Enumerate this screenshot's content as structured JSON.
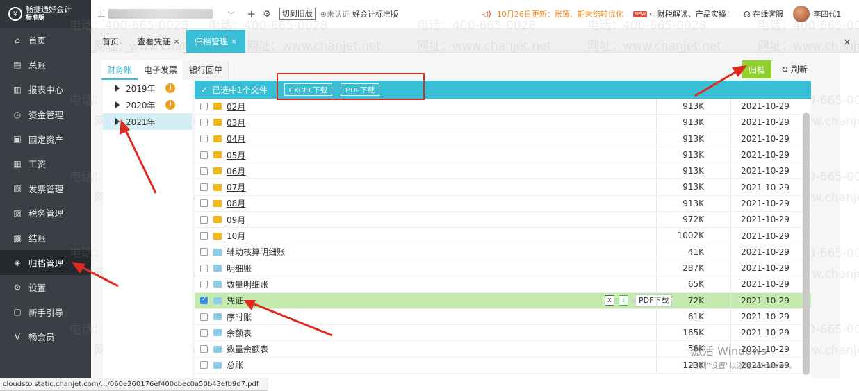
{
  "app": {
    "logo_name": "畅捷通好会计",
    "logo_edition": "标准版"
  },
  "sidebar": {
    "items": [
      {
        "label": "首页",
        "icon": "home-icon",
        "glyph": "⌂"
      },
      {
        "label": "总账",
        "icon": "ledger-icon",
        "glyph": "▤"
      },
      {
        "label": "报表中心",
        "icon": "chart-icon",
        "glyph": "▥"
      },
      {
        "label": "资金管理",
        "icon": "money-icon",
        "glyph": "◷"
      },
      {
        "label": "固定资产",
        "icon": "asset-icon",
        "glyph": "▣"
      },
      {
        "label": "工资",
        "icon": "salary-icon",
        "glyph": "▦"
      },
      {
        "label": "发票管理",
        "icon": "invoice-icon",
        "glyph": "▧"
      },
      {
        "label": "税务管理",
        "icon": "tax-icon",
        "glyph": "▨"
      },
      {
        "label": "结账",
        "icon": "checkout-icon",
        "glyph": "▩"
      },
      {
        "label": "归档管理",
        "icon": "archive-icon",
        "glyph": "◈",
        "active": true
      },
      {
        "label": "设置",
        "icon": "settings-icon",
        "glyph": "⚙"
      },
      {
        "label": "新手引导",
        "icon": "guide-icon",
        "glyph": "▢"
      },
      {
        "label": "畅会员",
        "icon": "member-icon",
        "glyph": "V"
      }
    ]
  },
  "topbar": {
    "company_prefix": "上",
    "switch_label": "切到旧版",
    "cert_label": "未认证",
    "edition_label": "好会计标准版",
    "notice": "10月26日更新：账簿、期末结转优化",
    "new_badge": "NEW",
    "tax_label": "财税解读、产品实操！",
    "support_label": "在线客服",
    "user_name": "李四代1"
  },
  "tabs": [
    {
      "label": "首页"
    },
    {
      "label": "查看凭证",
      "close": "×"
    },
    {
      "label": "归档管理",
      "close": "×",
      "active": true
    }
  ],
  "window_close": "×",
  "subtabs": [
    "财务账",
    "电子发票",
    "银行回单"
  ],
  "buttons": {
    "archive": "归档",
    "refresh": "刷新"
  },
  "tree": [
    {
      "label": "2019年",
      "badge": "i"
    },
    {
      "label": "2020年",
      "badge": "i"
    },
    {
      "label": "2021年",
      "selected": true
    }
  ],
  "file_header": {
    "selected_text": "已选中1个文件",
    "excel_btn": "EXCEL下载",
    "pdf_btn": "PDF下载"
  },
  "files": [
    {
      "name": "02月",
      "type": "folder",
      "size": "913K",
      "date": "2021-10-29",
      "link": true
    },
    {
      "name": "03月",
      "type": "folder",
      "size": "913K",
      "date": "2021-10-29",
      "link": true
    },
    {
      "name": "04月",
      "type": "folder",
      "size": "913K",
      "date": "2021-10-29",
      "link": true
    },
    {
      "name": "05月",
      "type": "folder",
      "size": "913K",
      "date": "2021-10-29",
      "link": true
    },
    {
      "name": "06月",
      "type": "folder",
      "size": "913K",
      "date": "2021-10-29",
      "link": true
    },
    {
      "name": "07月",
      "type": "folder",
      "size": "913K",
      "date": "2021-10-29",
      "link": true
    },
    {
      "name": "08月",
      "type": "folder",
      "size": "913K",
      "date": "2021-10-29",
      "link": true
    },
    {
      "name": "09月",
      "type": "folder",
      "size": "972K",
      "date": "2021-10-29",
      "link": true
    },
    {
      "name": "10月",
      "type": "folder",
      "size": "1002K",
      "date": "2021-10-29",
      "link": true
    },
    {
      "name": "辅助核算明细账",
      "type": "doc",
      "size": "41K",
      "date": "2021-10-29"
    },
    {
      "name": "明细账",
      "type": "doc",
      "size": "287K",
      "date": "2021-10-29"
    },
    {
      "name": "数量明细账",
      "type": "doc",
      "size": "65K",
      "date": "2021-10-29"
    },
    {
      "name": "凭证",
      "type": "doc",
      "size": "72K",
      "date": "2021-10-29",
      "checked": true,
      "tooltip": "PDF下载"
    },
    {
      "name": "序时账",
      "type": "doc",
      "size": "61K",
      "date": "2021-10-29"
    },
    {
      "name": "余额表",
      "type": "doc",
      "size": "165K",
      "date": "2021-10-29"
    },
    {
      "name": "数量余额表",
      "type": "doc",
      "size": "56K",
      "date": "2021-10-29"
    },
    {
      "name": "总账",
      "type": "doc",
      "size": "123K",
      "date": "2021-10-29"
    }
  ],
  "watermark": {
    "phone": "电话：400-665-0028",
    "site": "网址：www.chanjet.net"
  },
  "activation": {
    "title": "激活 Windows",
    "sub": "转到\"设置\"以激活 Windows。"
  },
  "status_url": "cloudsto.static.chanjet.com/.../060e260176ef400cbec0a50b43efb9d7.pdf"
}
